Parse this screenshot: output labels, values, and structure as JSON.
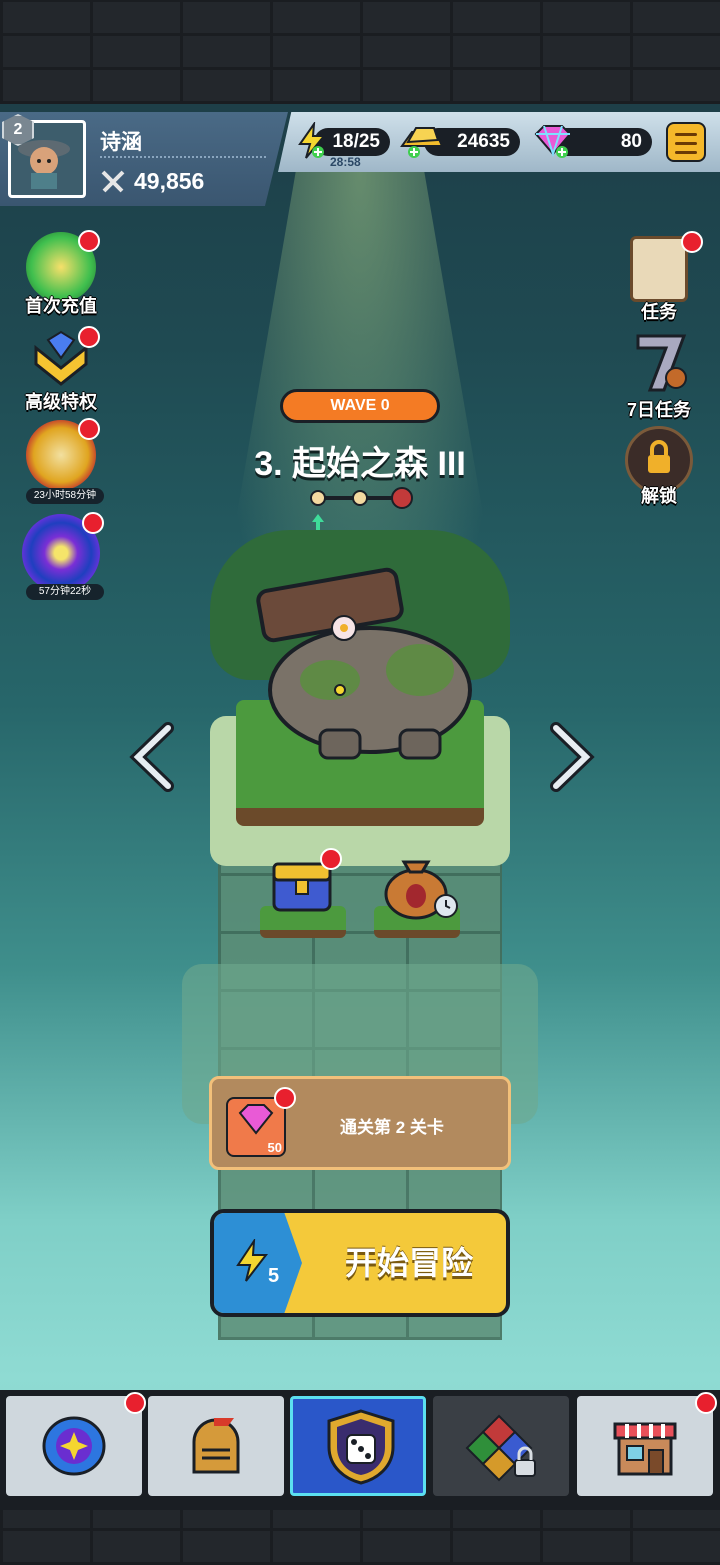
{
  "player": {
    "level": "2",
    "name": "诗涵",
    "power": "49,856"
  },
  "resources": {
    "energy": "18/25",
    "energy_timer": "28:58",
    "gold": "24635",
    "gems": "80"
  },
  "left_menu": [
    {
      "label": "首次充值",
      "timer": ""
    },
    {
      "label": "高级特权",
      "timer": ""
    },
    {
      "label": "",
      "timer": "23小时58分钟"
    },
    {
      "label": "",
      "timer": "57分钟22秒"
    }
  ],
  "right_menu": [
    {
      "label": "任务"
    },
    {
      "label": "7日任务"
    },
    {
      "label": "解锁"
    }
  ],
  "stage": {
    "wave": "WAVE 0",
    "title": "3. 起始之森 III"
  },
  "quest": {
    "reward_amount": "50",
    "description": "通关第 2 关卡"
  },
  "start_button": {
    "label": "开始冒险",
    "energy_cost": "5"
  },
  "tabs": [
    "heroes",
    "equipment",
    "battle",
    "talents",
    "shop"
  ],
  "colors": {
    "accent_orange": "#f47b24",
    "cta_yellow": "#f4c93a",
    "cta_blue": "#2d8fd5",
    "badge_red": "#e8202e"
  }
}
